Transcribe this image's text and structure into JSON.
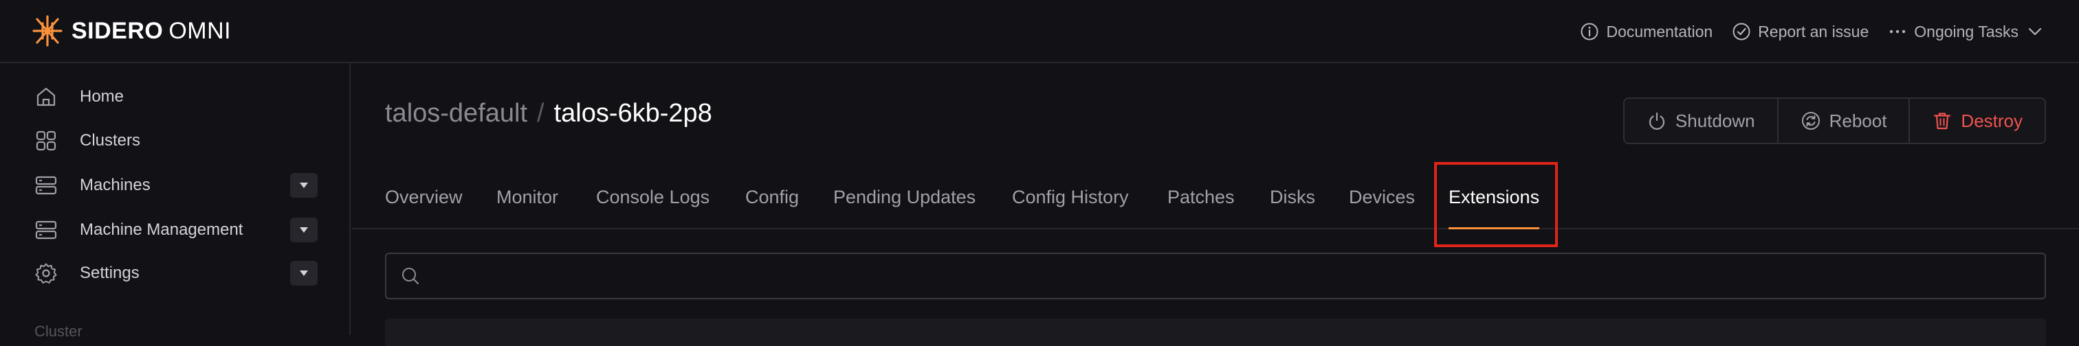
{
  "brand": {
    "name_bold": "SIDERO",
    "name_light": "OMNI",
    "accent": "#fb923c"
  },
  "header": {
    "actions": [
      {
        "label": "Documentation",
        "icon": "info-icon"
      },
      {
        "label": "Report an issue",
        "icon": "check-circle-icon"
      },
      {
        "label": "Ongoing Tasks",
        "icon": "ellipsis-icon"
      }
    ]
  },
  "sidebar": {
    "items": [
      {
        "label": "Home",
        "icon": "home-icon",
        "expandable": false
      },
      {
        "label": "Clusters",
        "icon": "grid-icon",
        "expandable": false
      },
      {
        "label": "Machines",
        "icon": "server-icon",
        "expandable": true
      },
      {
        "label": "Machine Management",
        "icon": "server-icon",
        "expandable": true
      },
      {
        "label": "Settings",
        "icon": "gear-icon",
        "expandable": true
      }
    ],
    "section_label": "Cluster"
  },
  "breadcrumb": {
    "cluster": "talos-default",
    "separator": "/",
    "node": "talos-6kb-2p8"
  },
  "node_actions": {
    "shutdown": "Shutdown",
    "reboot": "Reboot",
    "destroy": "Destroy",
    "danger_color": "#ef5350"
  },
  "tabs": [
    {
      "label": "Overview",
      "active": false
    },
    {
      "label": "Monitor",
      "active": false
    },
    {
      "label": "Console Logs",
      "active": false
    },
    {
      "label": "Config",
      "active": false
    },
    {
      "label": "Pending Updates",
      "active": false
    },
    {
      "label": "Config History",
      "active": false
    },
    {
      "label": "Patches",
      "active": false
    },
    {
      "label": "Disks",
      "active": false
    },
    {
      "label": "Devices",
      "active": false
    },
    {
      "label": "Extensions",
      "active": true
    }
  ],
  "search": {
    "value": "",
    "placeholder": ""
  }
}
